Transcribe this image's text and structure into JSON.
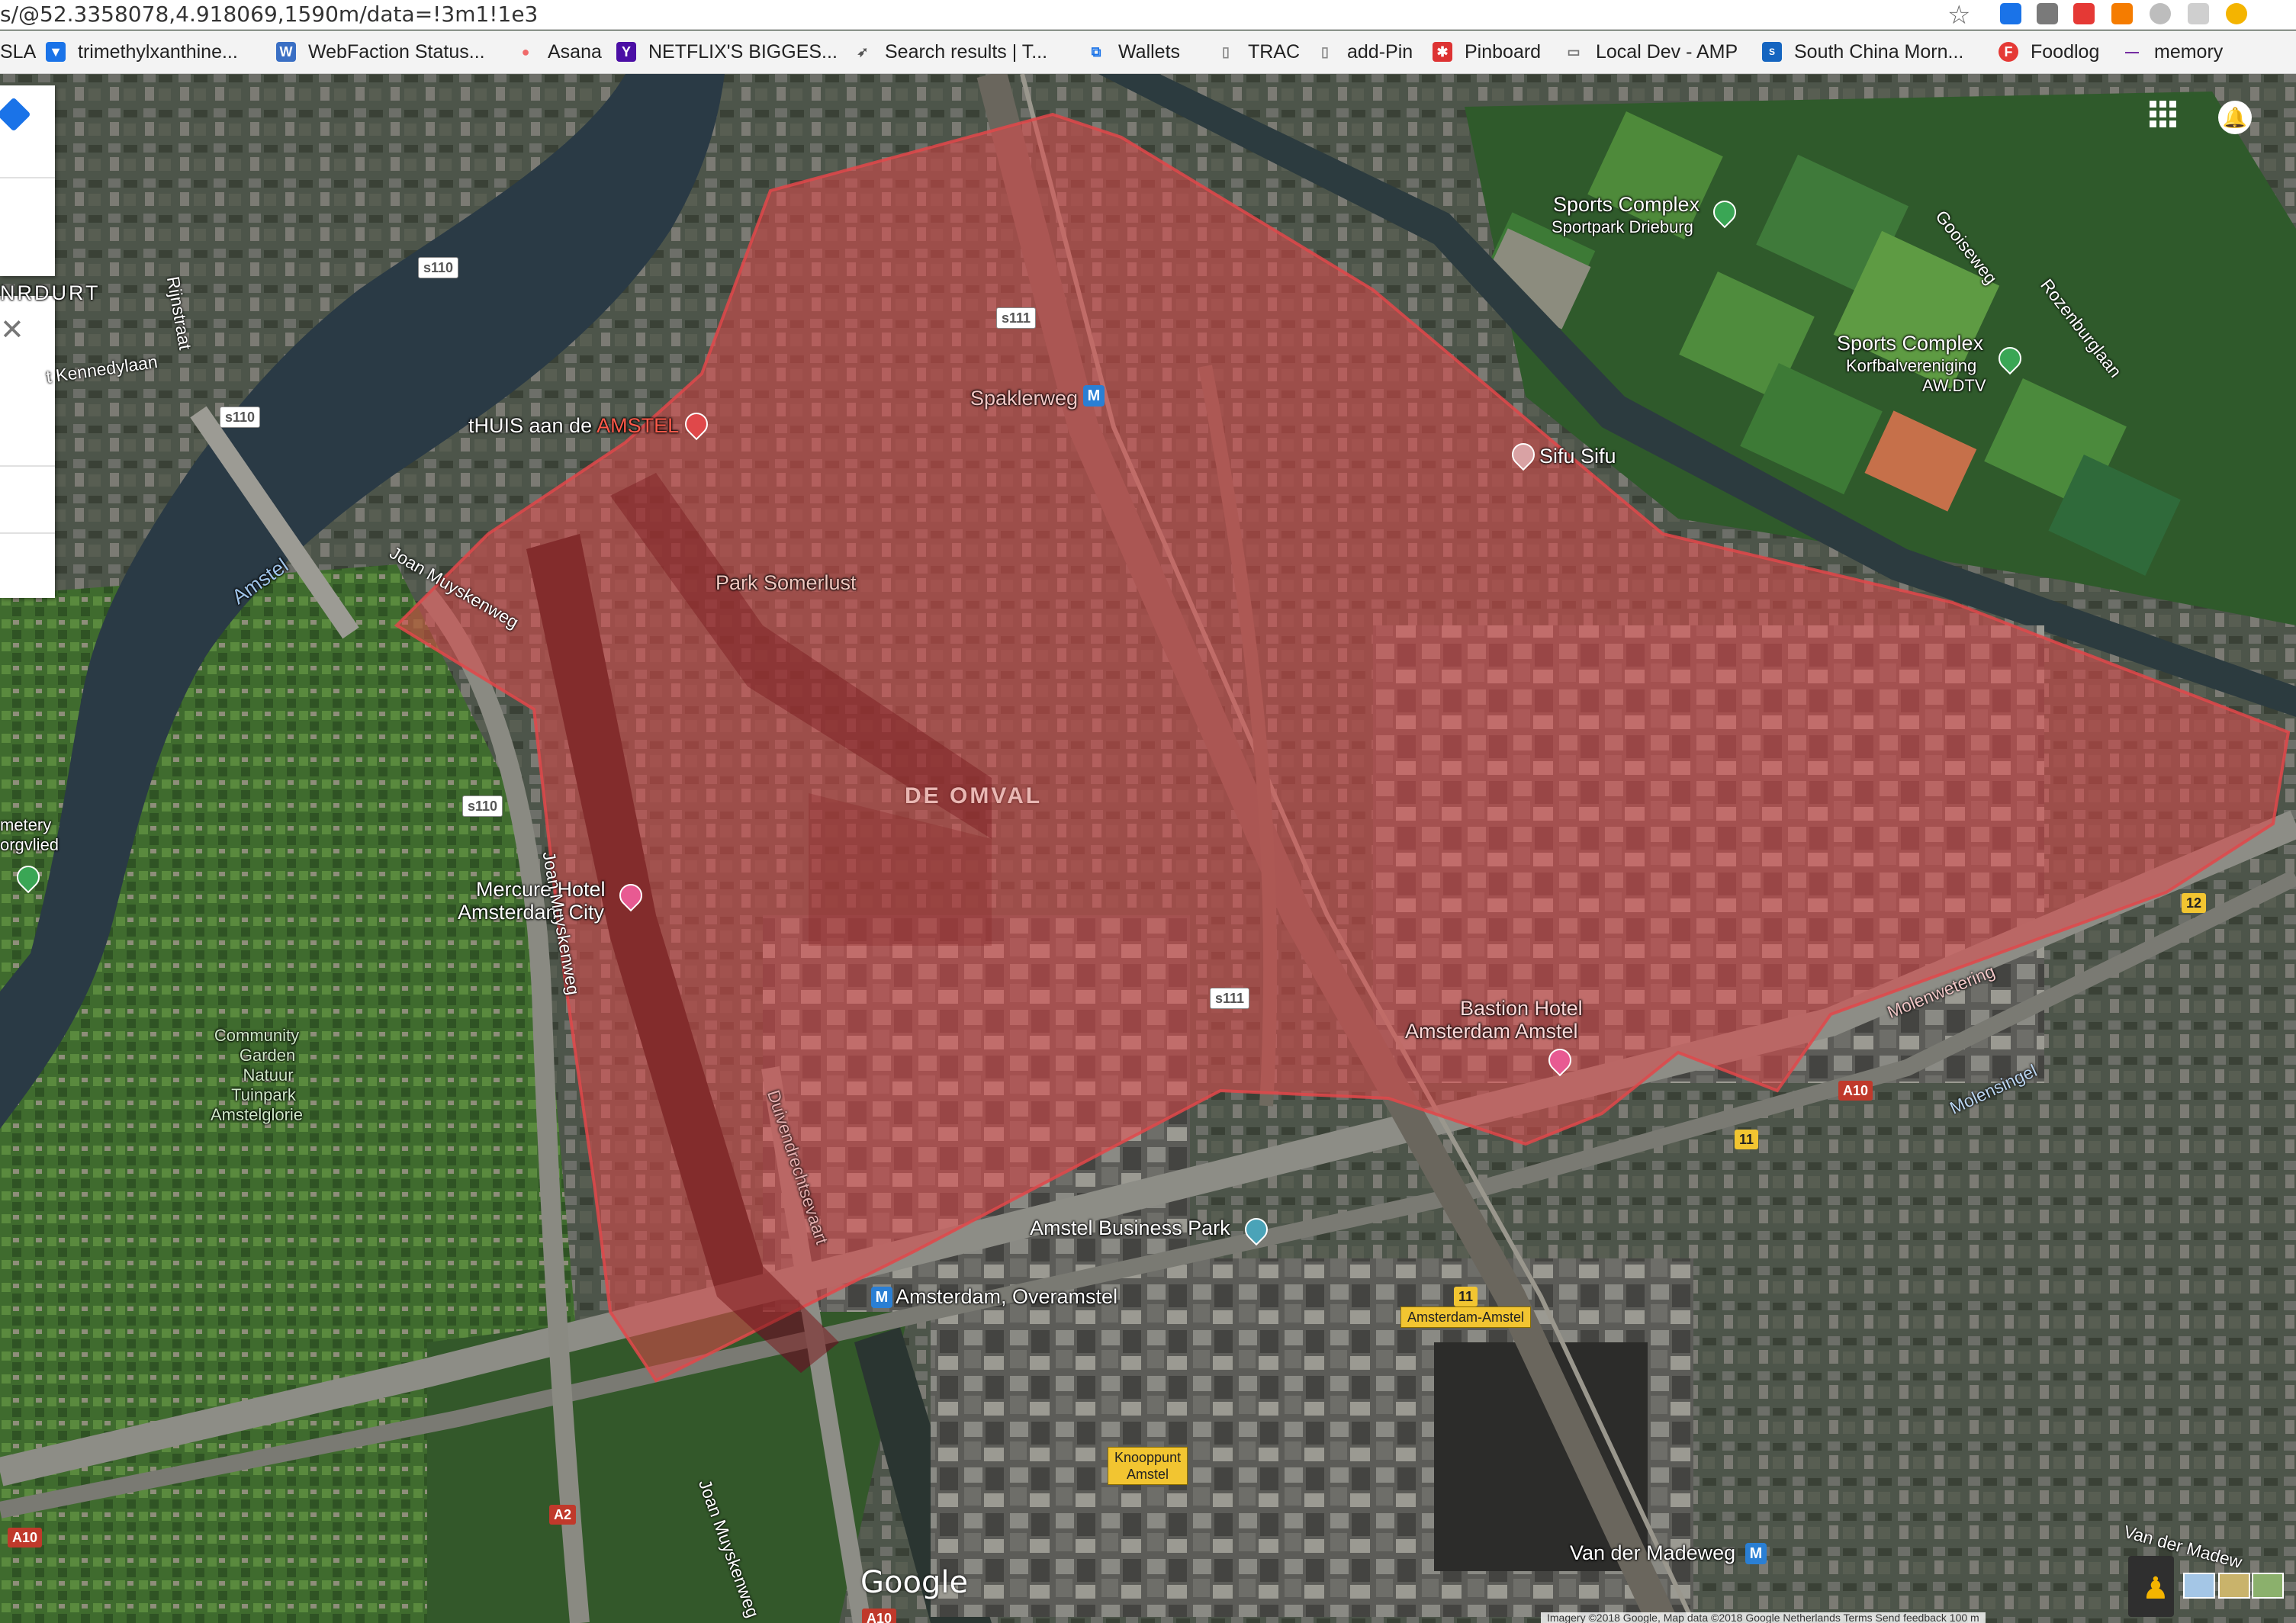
{
  "browser": {
    "url": "s/@52.3358078,4.918069,1590m/data=!3m1!1e3",
    "bookmarks": [
      {
        "label": "SLA",
        "color": "#ffffff",
        "glyph": ""
      },
      {
        "label": "trimethylxanthine...",
        "color": "#1a73e8",
        "glyph": "▼"
      },
      {
        "label": "WebFaction Status...",
        "color": "#3a6fc4",
        "glyph": "W"
      },
      {
        "label": "Asana",
        "color": "#f06a6a",
        "glyph": "●"
      },
      {
        "label": "NETFLIX'S BIGGES...",
        "color": "#4b0fa5",
        "glyph": "Y"
      },
      {
        "label": "Search results | T...",
        "color": "#555555",
        "glyph": "➶"
      },
      {
        "label": "Wallets",
        "color": "#1a73e8",
        "glyph": "⧉"
      },
      {
        "label": "TRAC",
        "color": "#aaaaaa",
        "glyph": "▯"
      },
      {
        "label": "add-Pin",
        "color": "#aaaaaa",
        "glyph": "▯"
      },
      {
        "label": "Pinboard",
        "color": "#d33",
        "glyph": "✱"
      },
      {
        "label": "Local Dev - AMP",
        "color": "#777777",
        "glyph": "▭"
      },
      {
        "label": "South China Morn...",
        "color": "#1565c0",
        "glyph": "S"
      },
      {
        "label": "Foodlog",
        "color": "#e53935",
        "glyph": "F"
      },
      {
        "label": "memory",
        "color": "#6a1b9a",
        "glyph": "—"
      }
    ]
  },
  "map": {
    "places": {
      "thuis_prefix": "tHUIS aan de ",
      "thuis_suffix": "AMSTEL",
      "spaklerweg": "Spaklerweg",
      "sifu": "Sifu Sifu",
      "park_somerlust": "Park Somerlust",
      "de_omval": "DE OMVAL",
      "mercure_1": "Mercure Hotel",
      "mercure_2": "Amsterdam City",
      "bastion_1": "Bastion Hotel",
      "bastion_2": "Amsterdam Amstel",
      "business_park": "Amstel Business Park",
      "overamstel": "Amsterdam, Overamstel",
      "van_der_madeweg": "Van der Madeweg",
      "sports1_title": "Sports Complex",
      "sports1_sub": "Sportpark Drieburg",
      "sports2_title": "Sports Complex",
      "sports2_sub1": "Korfbalvereniging",
      "sports2_sub2": "AW.DTV",
      "community_1": "Community",
      "community_2": "Garden",
      "community_3": "Natuur",
      "community_4": "Tuinpark",
      "community_5": "Amstelglorie",
      "cemetery_1": "metery",
      "cemetery_2": "orgvlied",
      "amstel_river": "Amstel",
      "nrdurt": "NRDURT"
    },
    "roads": {
      "rijnstraat": "Rijnstraat",
      "kennedylaan": "t Kennedylaan",
      "joan_1": "Joan Muyskenweg",
      "joan_2": "Joan Muyskenweg",
      "joan_3": "Joan Muyskenweg",
      "duivendrecht": "Duivendrechtsevaart",
      "gooiseweg": "Gooiseweg",
      "rozenburglaan": "Rozenburglaan",
      "molenwetering": "Molenwetering",
      "molensingel": "Molensingel",
      "van_der_madeweg_r": "Van der Madew"
    },
    "shields": {
      "s110a": "s110",
      "s110b": "s110",
      "s110c": "s110",
      "s111a": "s111",
      "s111b": "s111",
      "a10a": "A10",
      "a10b": "A10",
      "a10c": "A10",
      "a2": "A2",
      "n11a": "11",
      "n11b": "11",
      "n12": "12"
    },
    "signs": {
      "knooppunt_1": "Knooppunt",
      "knooppunt_2": "Amstel",
      "amsterdam_amstel": "Amsterdam-Amstel"
    },
    "google": "Google",
    "attribution": "Imagery ©2018 Google, Map data ©2018 Google   Netherlands   Terms   Send feedback   100 m",
    "polygon_color": "#e0484a"
  }
}
